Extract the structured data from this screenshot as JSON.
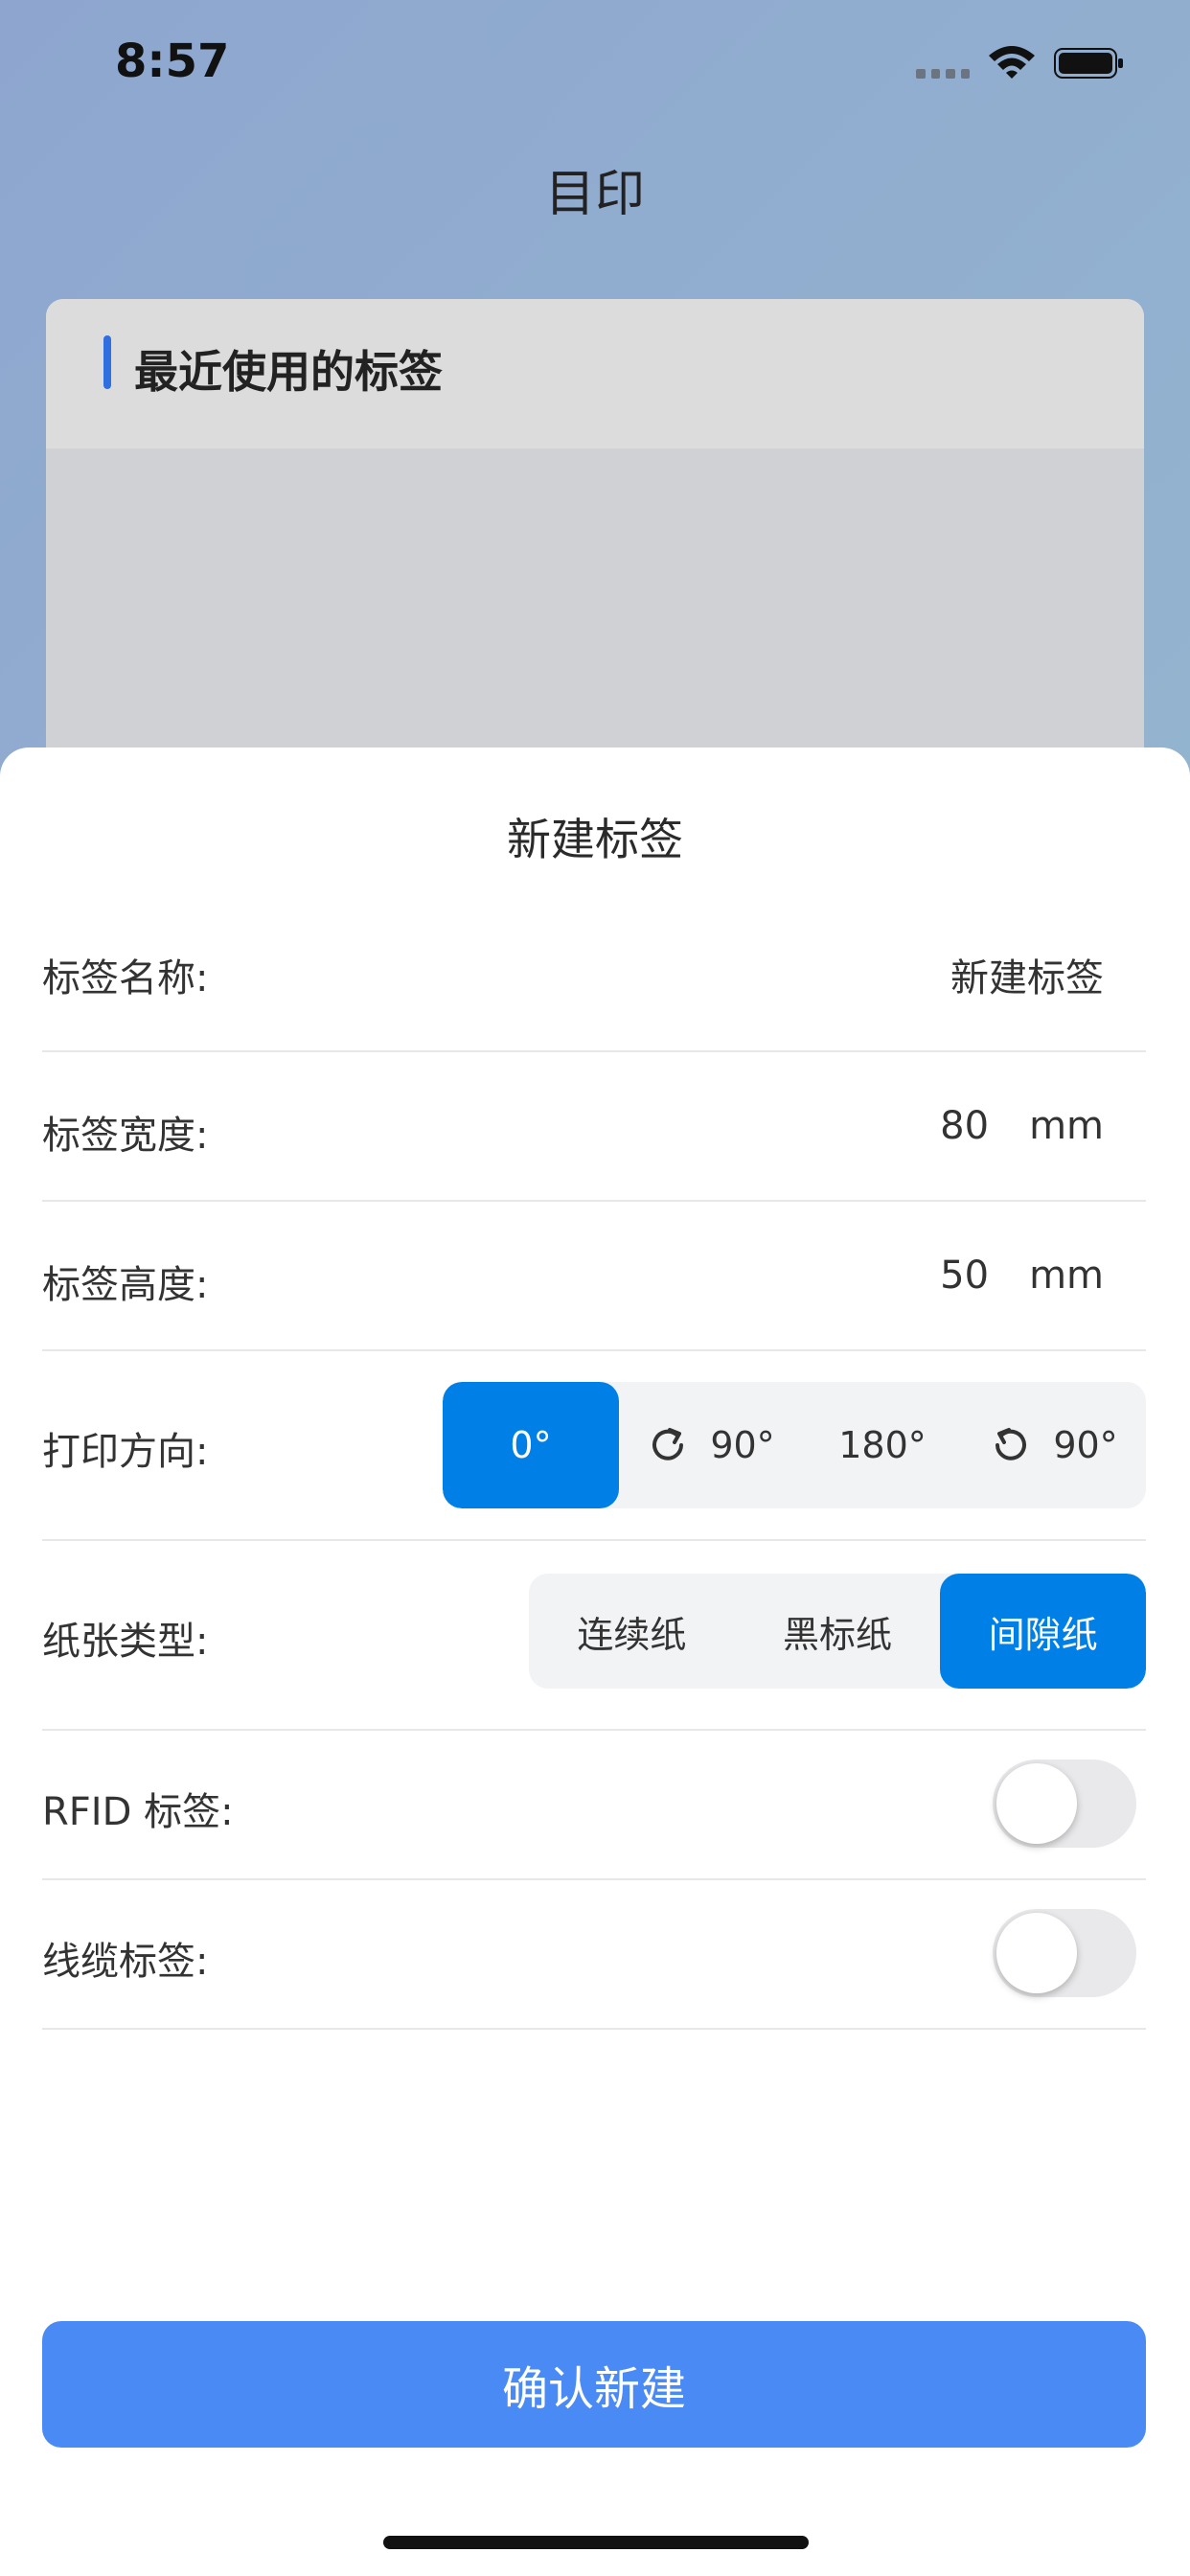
{
  "status_bar": {
    "time": "8:57"
  },
  "app": {
    "title": "目印"
  },
  "recent_card": {
    "title": "最近使用的标签"
  },
  "sheet": {
    "title": "新建标签",
    "name": {
      "label": "标签名称:",
      "value": "新建标签"
    },
    "width": {
      "label": "标签宽度:",
      "value": "80",
      "unit": "mm"
    },
    "height": {
      "label": "标签高度:",
      "value": "50",
      "unit": "mm"
    },
    "orientation": {
      "label": "打印方向:",
      "options": [
        "0°",
        "90°",
        "180°",
        "90°"
      ],
      "icons": [
        "",
        "rotate-clockwise-icon",
        "",
        "rotate-counterclockwise-icon"
      ],
      "selected": "0°"
    },
    "paper_type": {
      "label": "纸张类型:",
      "options": [
        "连续纸",
        "黑标纸",
        "间隙纸"
      ],
      "selected": "间隙纸"
    },
    "rfid": {
      "label": "RFID 标签:",
      "enabled": false
    },
    "cable": {
      "label": "线缆标签:",
      "enabled": false
    },
    "confirm_label": "确认新建"
  },
  "colors": {
    "accent": "#0080e6",
    "confirm": "#4a8af5",
    "card_bar": "#2f6fe0"
  }
}
